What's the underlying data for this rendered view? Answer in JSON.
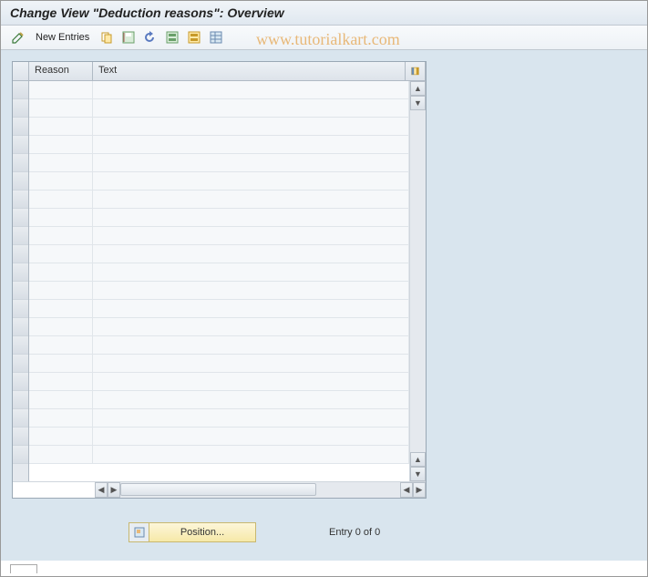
{
  "title": "Change View \"Deduction reasons\": Overview",
  "watermark": "www.tutorialkart.com",
  "toolbar": {
    "new_entries": "New Entries"
  },
  "table": {
    "columns": {
      "reason": "Reason",
      "text": "Text"
    },
    "rows": [
      {
        "reason": "",
        "text": ""
      },
      {
        "reason": "",
        "text": ""
      },
      {
        "reason": "",
        "text": ""
      },
      {
        "reason": "",
        "text": ""
      },
      {
        "reason": "",
        "text": ""
      },
      {
        "reason": "",
        "text": ""
      },
      {
        "reason": "",
        "text": ""
      },
      {
        "reason": "",
        "text": ""
      },
      {
        "reason": "",
        "text": ""
      },
      {
        "reason": "",
        "text": ""
      },
      {
        "reason": "",
        "text": ""
      },
      {
        "reason": "",
        "text": ""
      },
      {
        "reason": "",
        "text": ""
      },
      {
        "reason": "",
        "text": ""
      },
      {
        "reason": "",
        "text": ""
      },
      {
        "reason": "",
        "text": ""
      },
      {
        "reason": "",
        "text": ""
      },
      {
        "reason": "",
        "text": ""
      },
      {
        "reason": "",
        "text": ""
      },
      {
        "reason": "",
        "text": ""
      },
      {
        "reason": "",
        "text": ""
      }
    ]
  },
  "footer": {
    "position_label": "Position...",
    "entry_text": "Entry 0 of 0"
  }
}
